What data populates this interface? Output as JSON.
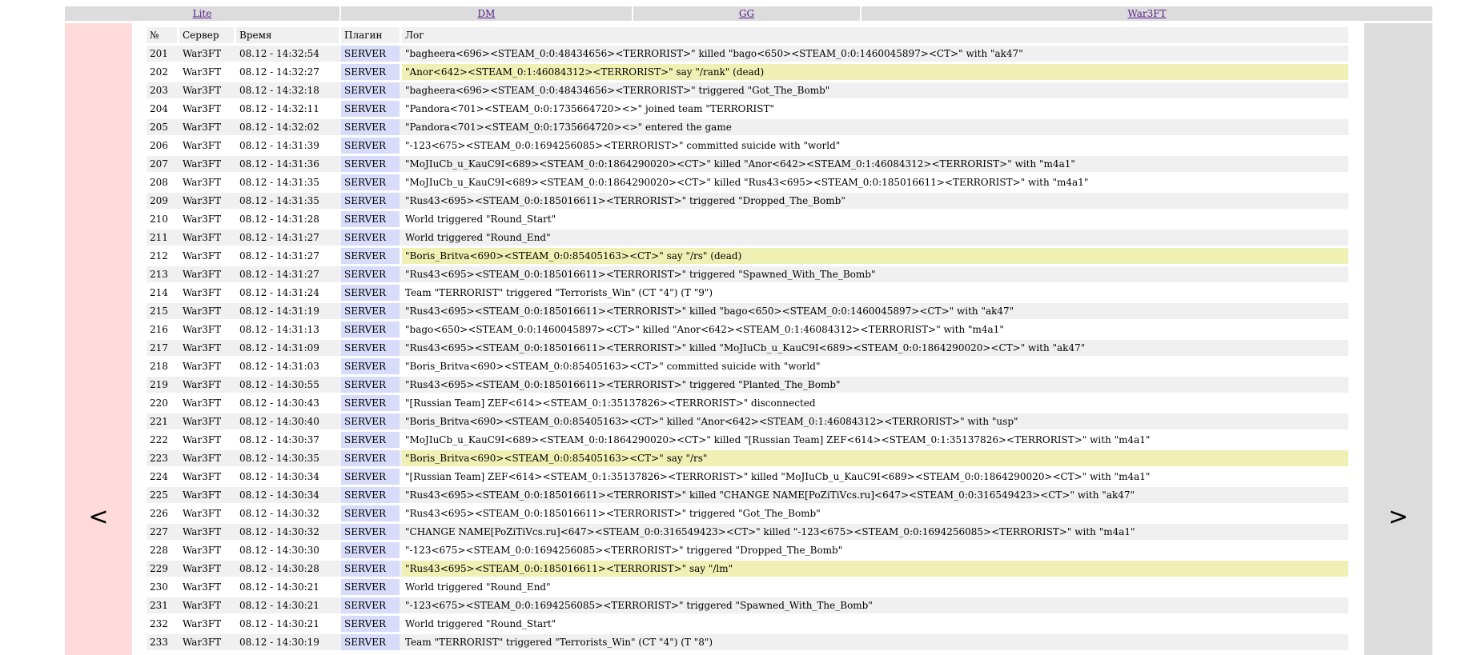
{
  "nav": {
    "links": [
      "Lite",
      "DM",
      "GG",
      "War3FT"
    ]
  },
  "pager": {
    "prev": "<",
    "next": ">"
  },
  "table": {
    "headers": [
      "№",
      "Сервер",
      "Время",
      "Плагин",
      "Лог"
    ],
    "rows": [
      {
        "no": "201",
        "server": "War3FT",
        "time": "08.12 - 14:32:54",
        "plugin": "SERVER",
        "log": "\"bagheera<696><STEAM_0:0:48434656><TERRORIST>\" killed \"bago<650><STEAM_0:0:1460045897><CT>\" with \"ak47\"",
        "hl": false
      },
      {
        "no": "202",
        "server": "War3FT",
        "time": "08.12 - 14:32:27",
        "plugin": "SERVER",
        "log": "\"Anor<642><STEAM_0:1:46084312><TERRORIST>\" say \"/rank\" (dead)",
        "hl": true
      },
      {
        "no": "203",
        "server": "War3FT",
        "time": "08.12 - 14:32:18",
        "plugin": "SERVER",
        "log": "\"bagheera<696><STEAM_0:0:48434656><TERRORIST>\" triggered \"Got_The_Bomb\"",
        "hl": false
      },
      {
        "no": "204",
        "server": "War3FT",
        "time": "08.12 - 14:32:11",
        "plugin": "SERVER",
        "log": "\"Pandora<701><STEAM_0:0:1735664720><>\" joined team \"TERRORIST\"",
        "hl": false
      },
      {
        "no": "205",
        "server": "War3FT",
        "time": "08.12 - 14:32:02",
        "plugin": "SERVER",
        "log": "\"Pandora<701><STEAM_0:0:1735664720><>\" entered the game",
        "hl": false
      },
      {
        "no": "206",
        "server": "War3FT",
        "time": "08.12 - 14:31:39",
        "plugin": "SERVER",
        "log": "\"-123<675><STEAM_0:0:1694256085><TERRORIST>\" committed suicide with \"world\"",
        "hl": false
      },
      {
        "no": "207",
        "server": "War3FT",
        "time": "08.12 - 14:31:36",
        "plugin": "SERVER",
        "log": "\"MoJIuCb_u_KauC9I<689><STEAM_0:0:1864290020><CT>\" killed \"Anor<642><STEAM_0:1:46084312><TERRORIST>\" with \"m4a1\"",
        "hl": false
      },
      {
        "no": "208",
        "server": "War3FT",
        "time": "08.12 - 14:31:35",
        "plugin": "SERVER",
        "log": "\"MoJIuCb_u_KauC9I<689><STEAM_0:0:1864290020><CT>\" killed \"Rus43<695><STEAM_0:0:185016611><TERRORIST>\" with \"m4a1\"",
        "hl": false
      },
      {
        "no": "209",
        "server": "War3FT",
        "time": "08.12 - 14:31:35",
        "plugin": "SERVER",
        "log": "\"Rus43<695><STEAM_0:0:185016611><TERRORIST>\" triggered \"Dropped_The_Bomb\"",
        "hl": false
      },
      {
        "no": "210",
        "server": "War3FT",
        "time": "08.12 - 14:31:28",
        "plugin": "SERVER",
        "log": "World triggered \"Round_Start\"",
        "hl": false
      },
      {
        "no": "211",
        "server": "War3FT",
        "time": "08.12 - 14:31:27",
        "plugin": "SERVER",
        "log": "World triggered \"Round_End\"",
        "hl": false
      },
      {
        "no": "212",
        "server": "War3FT",
        "time": "08.12 - 14:31:27",
        "plugin": "SERVER",
        "log": "\"Boris_Britva<690><STEAM_0:0:85405163><CT>\" say \"/rs\" (dead)",
        "hl": true
      },
      {
        "no": "213",
        "server": "War3FT",
        "time": "08.12 - 14:31:27",
        "plugin": "SERVER",
        "log": "\"Rus43<695><STEAM_0:0:185016611><TERRORIST>\" triggered \"Spawned_With_The_Bomb\"",
        "hl": false
      },
      {
        "no": "214",
        "server": "War3FT",
        "time": "08.12 - 14:31:24",
        "plugin": "SERVER",
        "log": "Team \"TERRORIST\" triggered \"Terrorists_Win\" (CT \"4\") (T \"9\")",
        "hl": false
      },
      {
        "no": "215",
        "server": "War3FT",
        "time": "08.12 - 14:31:19",
        "plugin": "SERVER",
        "log": "\"Rus43<695><STEAM_0:0:185016611><TERRORIST>\" killed \"bago<650><STEAM_0:0:1460045897><CT>\" with \"ak47\"",
        "hl": false
      },
      {
        "no": "216",
        "server": "War3FT",
        "time": "08.12 - 14:31:13",
        "plugin": "SERVER",
        "log": "\"bago<650><STEAM_0:0:1460045897><CT>\" killed \"Anor<642><STEAM_0:1:46084312><TERRORIST>\" with \"m4a1\"",
        "hl": false
      },
      {
        "no": "217",
        "server": "War3FT",
        "time": "08.12 - 14:31:09",
        "plugin": "SERVER",
        "log": "\"Rus43<695><STEAM_0:0:185016611><TERRORIST>\" killed \"MoJIuCb_u_KauC9I<689><STEAM_0:0:1864290020><CT>\" with \"ak47\"",
        "hl": false
      },
      {
        "no": "218",
        "server": "War3FT",
        "time": "08.12 - 14:31:03",
        "plugin": "SERVER",
        "log": "\"Boris_Britva<690><STEAM_0:0:85405163><CT>\" committed suicide with \"world\"",
        "hl": false
      },
      {
        "no": "219",
        "server": "War3FT",
        "time": "08.12 - 14:30:55",
        "plugin": "SERVER",
        "log": "\"Rus43<695><STEAM_0:0:185016611><TERRORIST>\" triggered \"Planted_The_Bomb\"",
        "hl": false
      },
      {
        "no": "220",
        "server": "War3FT",
        "time": "08.12 - 14:30:43",
        "plugin": "SERVER",
        "log": "\"[Russian Team] ZEF<614><STEAM_0:1:35137826><TERRORIST>\" disconnected",
        "hl": false
      },
      {
        "no": "221",
        "server": "War3FT",
        "time": "08.12 - 14:30:40",
        "plugin": "SERVER",
        "log": "\"Boris_Britva<690><STEAM_0:0:85405163><CT>\" killed \"Anor<642><STEAM_0:1:46084312><TERRORIST>\" with \"usp\"",
        "hl": false
      },
      {
        "no": "222",
        "server": "War3FT",
        "time": "08.12 - 14:30:37",
        "plugin": "SERVER",
        "log": "\"MoJIuCb_u_KauC9I<689><STEAM_0:0:1864290020><CT>\" killed \"[Russian Team] ZEF<614><STEAM_0:1:35137826><TERRORIST>\" with \"m4a1\"",
        "hl": false
      },
      {
        "no": "223",
        "server": "War3FT",
        "time": "08.12 - 14:30:35",
        "plugin": "SERVER",
        "log": "\"Boris_Britva<690><STEAM_0:0:85405163><CT>\" say \"/rs\"",
        "hl": true
      },
      {
        "no": "224",
        "server": "War3FT",
        "time": "08.12 - 14:30:34",
        "plugin": "SERVER",
        "log": "\"[Russian Team] ZEF<614><STEAM_0:1:35137826><TERRORIST>\" killed \"MoJIuCb_u_KauC9I<689><STEAM_0:0:1864290020><CT>\" with \"m4a1\"",
        "hl": false
      },
      {
        "no": "225",
        "server": "War3FT",
        "time": "08.12 - 14:30:34",
        "plugin": "SERVER",
        "log": "\"Rus43<695><STEAM_0:0:185016611><TERRORIST>\" killed \"CHANGE NAME[PoZiTiVcs.ru]<647><STEAM_0:0:316549423><CT>\" with \"ak47\"",
        "hl": false
      },
      {
        "no": "226",
        "server": "War3FT",
        "time": "08.12 - 14:30:32",
        "plugin": "SERVER",
        "log": "\"Rus43<695><STEAM_0:0:185016611><TERRORIST>\" triggered \"Got_The_Bomb\"",
        "hl": false
      },
      {
        "no": "227",
        "server": "War3FT",
        "time": "08.12 - 14:30:32",
        "plugin": "SERVER",
        "log": "\"CHANGE NAME[PoZiTiVcs.ru]<647><STEAM_0:0:316549423><CT>\" killed \"-123<675><STEAM_0:0:1694256085><TERRORIST>\" with \"m4a1\"",
        "hl": false
      },
      {
        "no": "228",
        "server": "War3FT",
        "time": "08.12 - 14:30:30",
        "plugin": "SERVER",
        "log": "\"-123<675><STEAM_0:0:1694256085><TERRORIST>\" triggered \"Dropped_The_Bomb\"",
        "hl": false
      },
      {
        "no": "229",
        "server": "War3FT",
        "time": "08.12 - 14:30:28",
        "plugin": "SERVER",
        "log": "\"Rus43<695><STEAM_0:0:185016611><TERRORIST>\" say \"/lm\"",
        "hl": true
      },
      {
        "no": "230",
        "server": "War3FT",
        "time": "08.12 - 14:30:21",
        "plugin": "SERVER",
        "log": "World triggered \"Round_End\"",
        "hl": false
      },
      {
        "no": "231",
        "server": "War3FT",
        "time": "08.12 - 14:30:21",
        "plugin": "SERVER",
        "log": "\"-123<675><STEAM_0:0:1694256085><TERRORIST>\" triggered \"Spawned_With_The_Bomb\"",
        "hl": false
      },
      {
        "no": "232",
        "server": "War3FT",
        "time": "08.12 - 14:30:21",
        "plugin": "SERVER",
        "log": "World triggered \"Round_Start\"",
        "hl": false
      },
      {
        "no": "233",
        "server": "War3FT",
        "time": "08.12 - 14:30:19",
        "plugin": "SERVER",
        "log": "Team \"TERRORIST\" triggered \"Terrorists_Win\" (CT \"4\") (T \"8\")",
        "hl": false
      }
    ]
  }
}
